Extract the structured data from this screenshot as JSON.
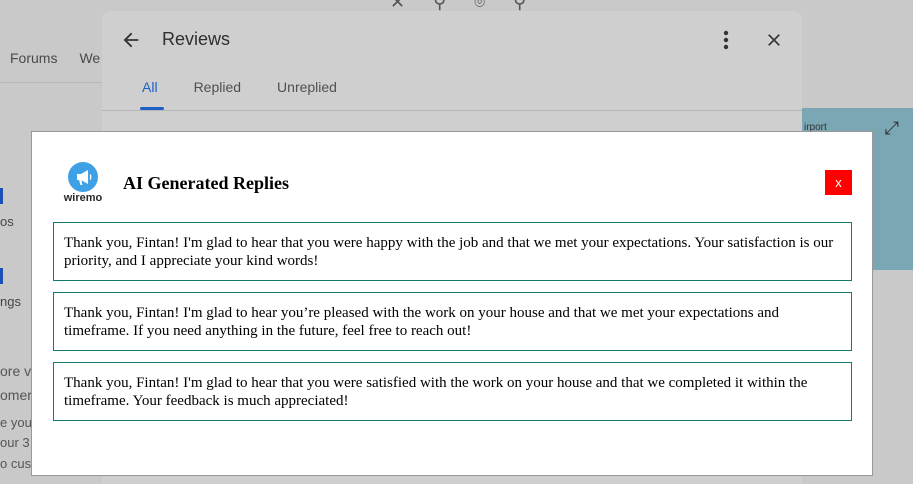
{
  "background": {
    "nav": [
      "Forums",
      "We"
    ],
    "side_items": [
      "os",
      "ngs"
    ],
    "left_lines": [
      "ore v",
      "omer",
      "e you",
      "our 3",
      "o cus"
    ],
    "map_label": "irport"
  },
  "reviews_panel": {
    "title": "Reviews",
    "tabs": [
      {
        "label": "All",
        "active": true
      },
      {
        "label": "Replied",
        "active": false
      },
      {
        "label": "Unreplied",
        "active": false
      }
    ]
  },
  "ai_modal": {
    "logo_text": "wiremo",
    "title": "AI Generated Replies",
    "close_label": "x",
    "replies": [
      "Thank you, Fintan! I'm glad to hear that you were happy with the job and that we met your expectations. Your satisfaction is our priority, and I appreciate your kind words!",
      "Thank you, Fintan! I'm glad to hear you’re pleased with the work on your house and that we met your expectations and timeframe. If you need anything in the future, feel free to reach out!",
      "Thank you, Fintan! I'm glad to hear that you were satisfied with the work on your house and that we completed it within the timeframe. Your feedback is much appreciated!"
    ]
  },
  "colors": {
    "accent_blue": "#1d5fc7",
    "close_red": "#ff0000",
    "card_border": "#157a6e",
    "logo_blue": "#3ea0e5"
  }
}
